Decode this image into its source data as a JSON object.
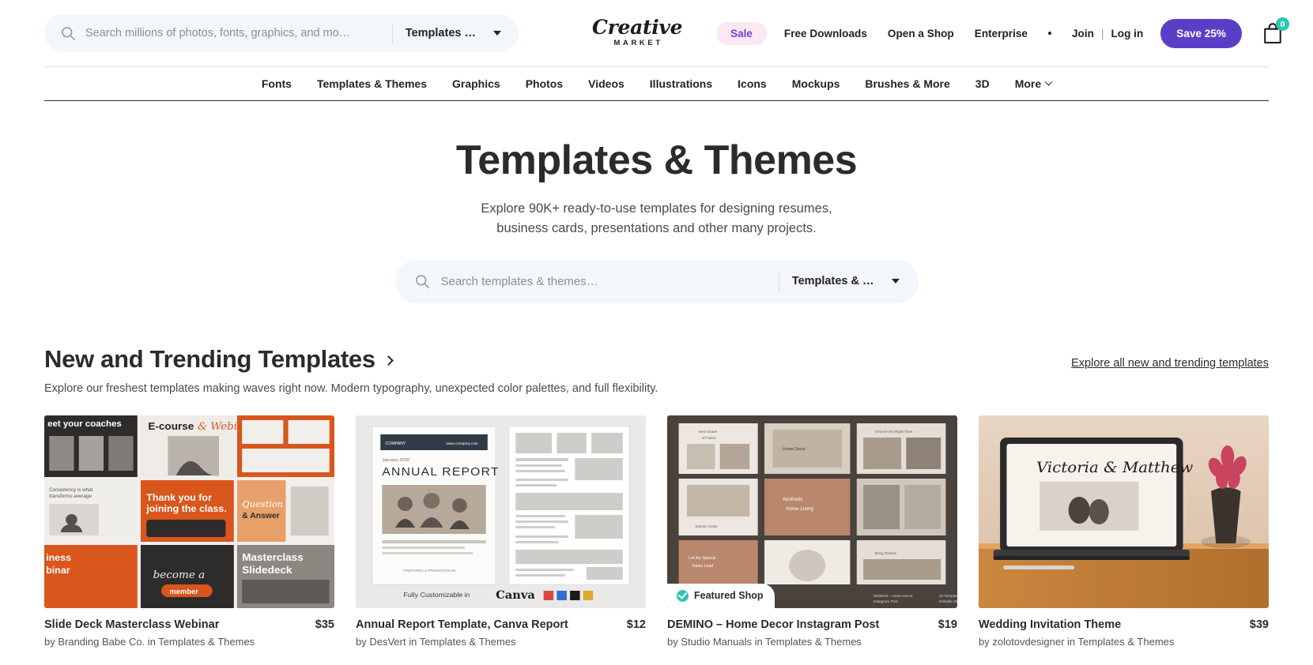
{
  "header": {
    "search": {
      "placeholder": "Search millions of photos, fonts, graphics, and mo…",
      "category": "Templates …",
      "icon": "search-icon"
    },
    "brand": {
      "main": "Creative",
      "sub": "MARKET"
    },
    "sale_label": "Sale",
    "links": [
      "Free Downloads",
      "Open a Shop",
      "Enterprise"
    ],
    "join_label": "Join",
    "separator": "|",
    "login_label": "Log in",
    "save_button": "Save 25%",
    "cart": {
      "icon": "shopping-bag-icon",
      "count": "0",
      "badge_color": "#2ec4b0"
    }
  },
  "category_nav": {
    "items": [
      {
        "label": "Fonts",
        "has_chevron": false
      },
      {
        "label": "Templates & Themes",
        "has_chevron": false
      },
      {
        "label": "Graphics",
        "has_chevron": false
      },
      {
        "label": "Photos",
        "has_chevron": false
      },
      {
        "label": "Videos",
        "has_chevron": false
      },
      {
        "label": "Illustrations",
        "has_chevron": false
      },
      {
        "label": "Icons",
        "has_chevron": false
      },
      {
        "label": "Mockups",
        "has_chevron": false
      },
      {
        "label": "Brushes & More",
        "has_chevron": false
      },
      {
        "label": "3D",
        "has_chevron": false
      },
      {
        "label": "More",
        "has_chevron": true
      }
    ]
  },
  "hero": {
    "title": "Templates & Themes",
    "subtitle_line1": "Explore 90K+ ready-to-use templates for designing resumes,",
    "subtitle_line2": "business cards, presentations and other many projects.",
    "search": {
      "placeholder": "Search templates & themes…",
      "category": "Templates & …",
      "icon": "search-icon"
    }
  },
  "section": {
    "title": "New and Trending Templates",
    "subtitle": "Explore our freshest templates making waves right now. Modern typography, unexpected color palettes, and full flexibility.",
    "explore_link": "Explore all new and trending templates"
  },
  "cards": [
    {
      "title": "Slide Deck Masterclass Webinar",
      "price": "$35",
      "by": "by Branding Babe Co. in Templates & Themes",
      "badge": null
    },
    {
      "title": "Annual Report Template, Canva Report",
      "price": "$12",
      "by": "by DesVert in Templates & Themes",
      "badge": null
    },
    {
      "title": "DEMINO – Home Decor Instagram Post",
      "price": "$19",
      "by": "by Studio Manuals in Templates & Themes",
      "badge": "Featured Shop"
    },
    {
      "title": "Wedding Invitation Theme",
      "price": "$39",
      "by": "by zolotovdesigner in Templates & Themes",
      "badge": null
    }
  ],
  "colors": {
    "accent_purple": "#5b3ec8",
    "sale_pill_bg": "#fbe8f3",
    "sale_pill_text": "#6b42d9",
    "teal": "#2ec4b0",
    "search_bg": "#f3f6fa",
    "text": "#2b2b2b"
  }
}
